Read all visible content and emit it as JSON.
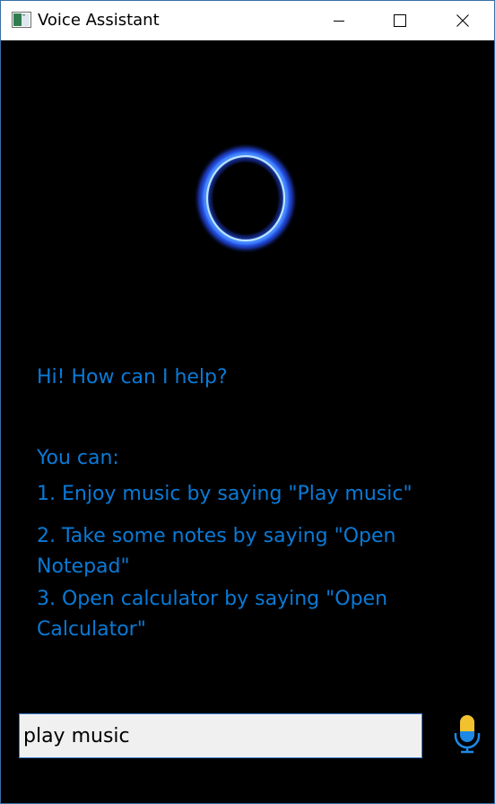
{
  "window": {
    "title": "Voice Assistant"
  },
  "assistant": {
    "greeting": "Hi! How can I help?",
    "help_heading": "You can:",
    "commands": [
      "1. Enjoy music by saying \"Play music\"",
      "2. Take some notes by saying \"Open Notepad\"",
      "3. Open calculator by saying \"Open Calculator\""
    ]
  },
  "input": {
    "value": "play music"
  },
  "icons": {
    "app": "app-window-icon",
    "minimize": "minimize-icon",
    "maximize": "maximize-icon",
    "close": "close-icon",
    "orb": "assistant-orb-icon",
    "mic": "microphone-icon"
  },
  "colors": {
    "background": "#000000",
    "text_accent": "#0a7ad6",
    "orb_glow": "#2a6bff",
    "mic_yellow": "#f2c12e",
    "mic_blue": "#1e88e5"
  }
}
